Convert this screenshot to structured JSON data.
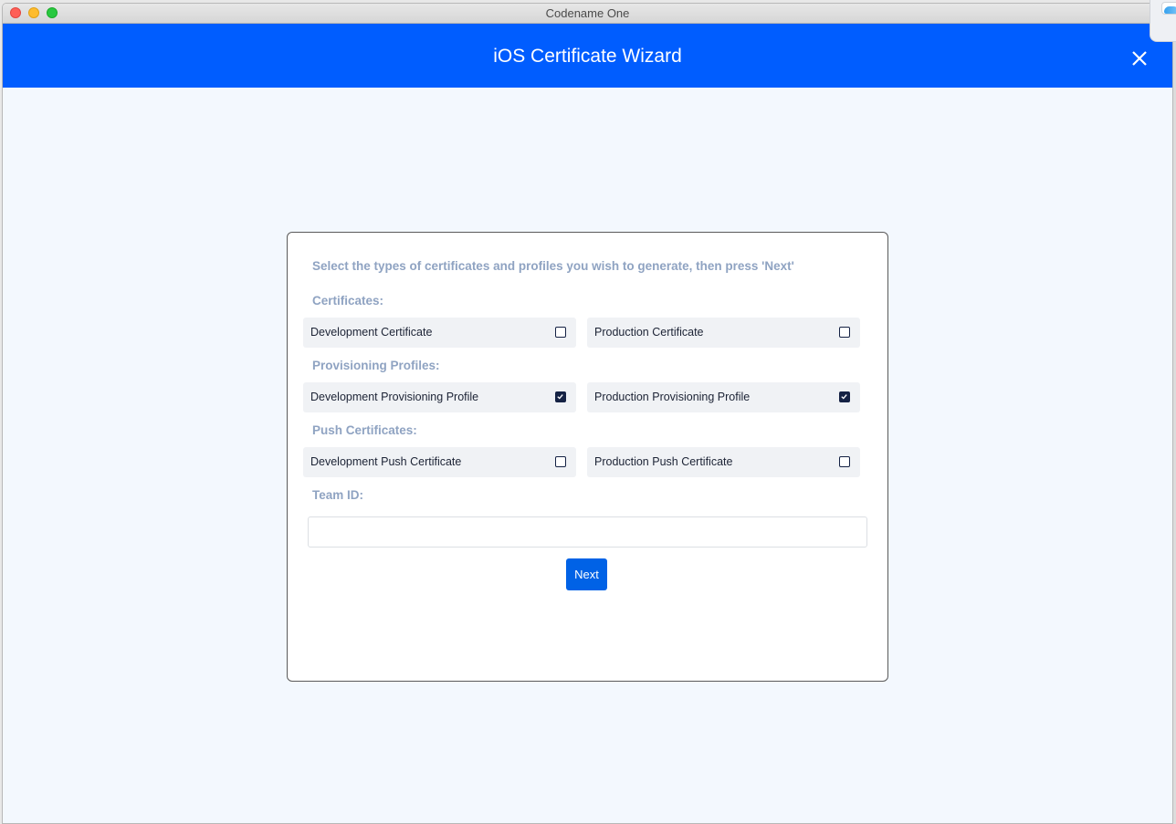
{
  "window": {
    "title": "Codename One"
  },
  "header": {
    "title": "iOS Certificate Wizard",
    "close_icon": "close-icon"
  },
  "colors": {
    "header_bg": "#005dff",
    "section_label": "#8fa3c2",
    "button_bg": "#0062e6",
    "checkbox": "#152244"
  },
  "wizard": {
    "intro": "Select the types of certificates and profiles you wish to generate, then press 'Next'",
    "sections": [
      {
        "label": "Certificates:",
        "options": [
          {
            "label": "Development Certificate",
            "checked": false
          },
          {
            "label": "Production Certificate",
            "checked": false
          }
        ]
      },
      {
        "label": "Provisioning Profiles:",
        "options": [
          {
            "label": "Development Provisioning Profile",
            "checked": true
          },
          {
            "label": "Production Provisioning Profile",
            "checked": true
          }
        ]
      },
      {
        "label": "Push Certificates:",
        "options": [
          {
            "label": "Development Push Certificate",
            "checked": false
          },
          {
            "label": "Production Push Certificate",
            "checked": false
          }
        ]
      }
    ],
    "team_id": {
      "label": "Team ID:",
      "value": "",
      "placeholder": ""
    },
    "next_label": "Next"
  }
}
